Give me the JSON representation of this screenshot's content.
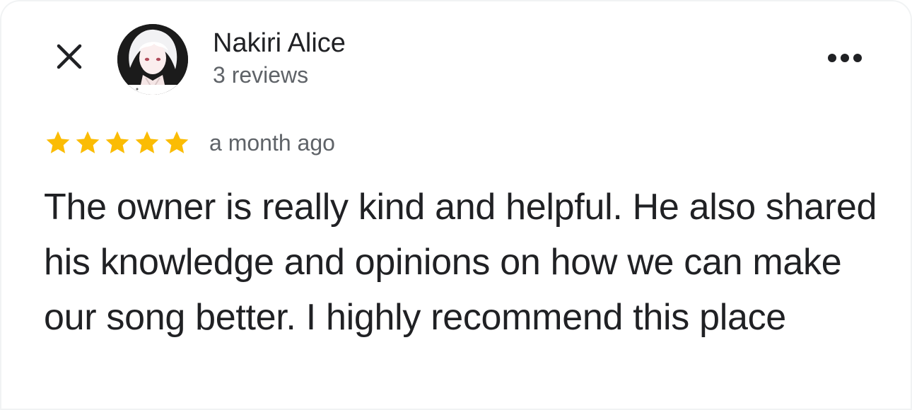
{
  "reviewer": {
    "name": "Nakiri Alice",
    "review_count": "3 reviews"
  },
  "review": {
    "rating": 5,
    "rating_max": 5,
    "time": "a month ago",
    "text": "The owner is really kind and helpful. He also shared his knowledge and opinions on how we can make our song better. I highly recommend this place"
  },
  "icons": {
    "close": "close-icon",
    "more": "more-horiz-icon",
    "star": "star-icon"
  },
  "colors": {
    "star": "#fbbc04",
    "text_primary": "#202124",
    "text_secondary": "#5f6368"
  }
}
